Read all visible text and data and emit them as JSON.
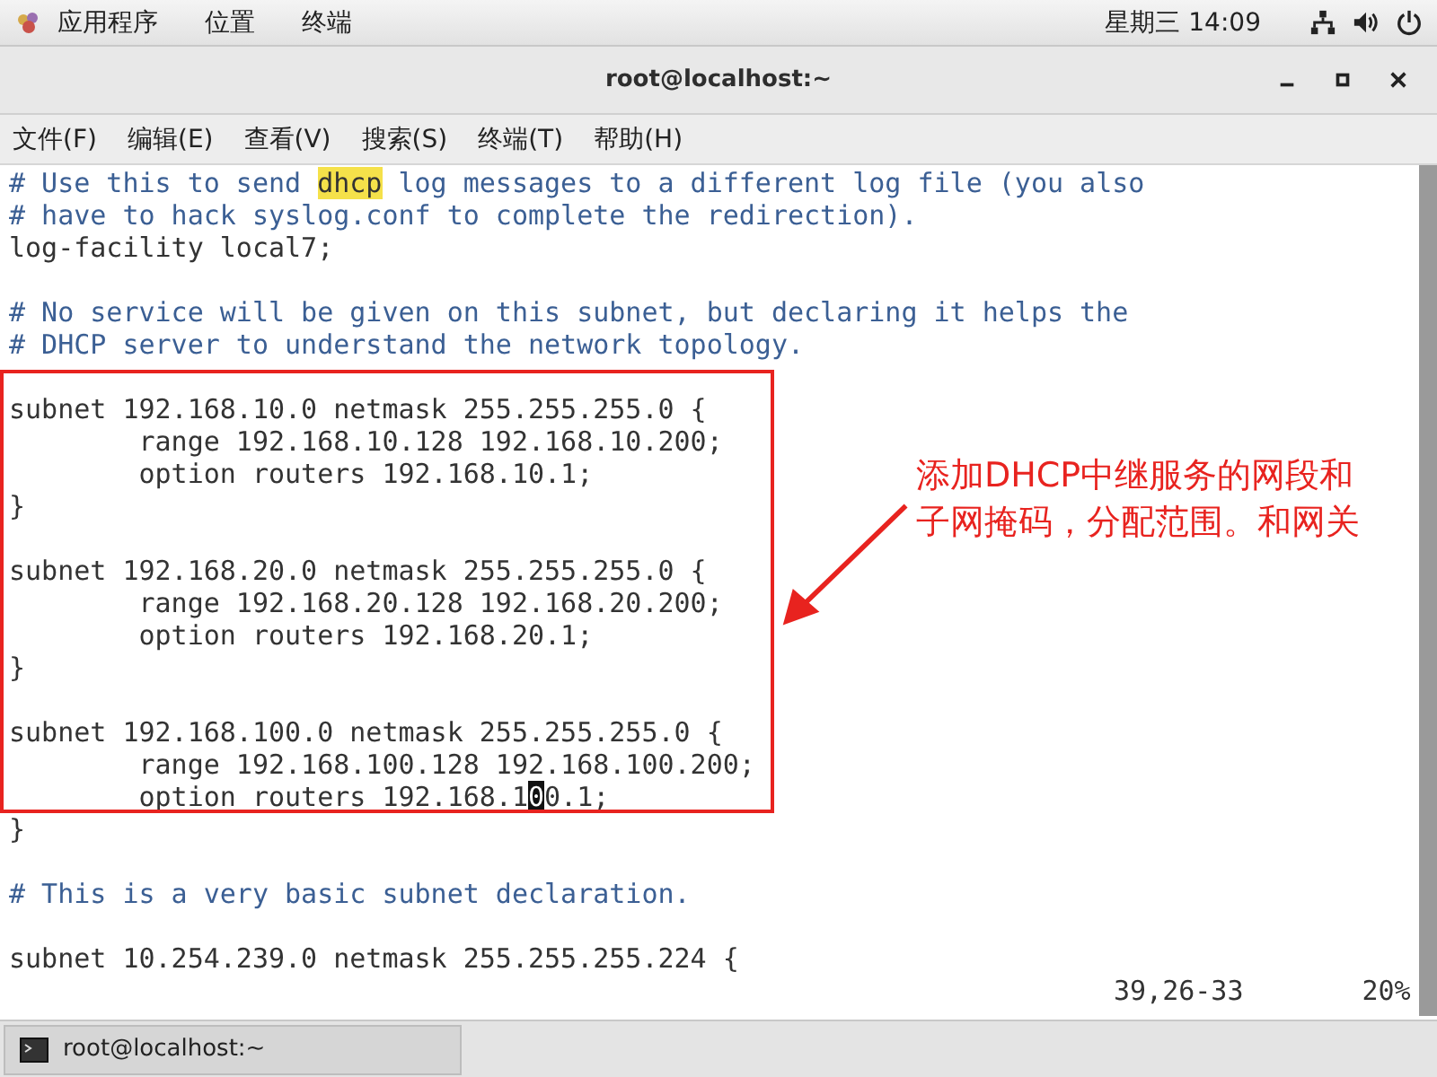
{
  "top_bar": {
    "menus": [
      "应用程序",
      "位置",
      "终端"
    ],
    "clock": "星期三 14:09"
  },
  "window": {
    "title": "root@localhost:~"
  },
  "menu_bar": [
    "文件(F)",
    "编辑(E)",
    "查看(V)",
    "搜索(S)",
    "终端(T)",
    "帮助(H)"
  ],
  "terminal": {
    "lines": [
      {
        "kind": "comment",
        "segments": [
          {
            "kind": "plain",
            "text": "# Use this to send "
          },
          {
            "kind": "match",
            "text": "dhcp"
          },
          {
            "kind": "plain",
            "text": " log messages to a different log file (you also"
          }
        ]
      },
      {
        "kind": "comment",
        "segments": [
          {
            "kind": "plain",
            "text": "# have to hack syslog.conf to complete the redirection)."
          }
        ]
      },
      {
        "kind": "code",
        "segments": [
          {
            "kind": "plain",
            "text": "log-facility local7;"
          }
        ]
      },
      {
        "kind": "blank"
      },
      {
        "kind": "comment",
        "segments": [
          {
            "kind": "plain",
            "text": "# No service will be given on this subnet, but declaring it helps the"
          }
        ]
      },
      {
        "kind": "comment",
        "segments": [
          {
            "kind": "plain",
            "text": "# DHCP server to understand the network topology."
          }
        ]
      },
      {
        "kind": "blank"
      },
      {
        "kind": "code",
        "segments": [
          {
            "kind": "plain",
            "text": "subnet 192.168.10.0 netmask 255.255.255.0 {"
          }
        ]
      },
      {
        "kind": "code",
        "segments": [
          {
            "kind": "plain",
            "text": "        range 192.168.10.128 192.168.10.200;"
          }
        ]
      },
      {
        "kind": "code",
        "segments": [
          {
            "kind": "plain",
            "text": "        option routers 192.168.10.1;"
          }
        ]
      },
      {
        "kind": "code",
        "segments": [
          {
            "kind": "plain",
            "text": "}"
          }
        ]
      },
      {
        "kind": "blank"
      },
      {
        "kind": "code",
        "segments": [
          {
            "kind": "plain",
            "text": "subnet 192.168.20.0 netmask 255.255.255.0 {"
          }
        ]
      },
      {
        "kind": "code",
        "segments": [
          {
            "kind": "plain",
            "text": "        range 192.168.20.128 192.168.20.200;"
          }
        ]
      },
      {
        "kind": "code",
        "segments": [
          {
            "kind": "plain",
            "text": "        option routers 192.168.20.1;"
          }
        ]
      },
      {
        "kind": "code",
        "segments": [
          {
            "kind": "plain",
            "text": "}"
          }
        ]
      },
      {
        "kind": "blank"
      },
      {
        "kind": "code",
        "segments": [
          {
            "kind": "plain",
            "text": "subnet 192.168.100.0 netmask 255.255.255.0 {"
          }
        ]
      },
      {
        "kind": "code",
        "segments": [
          {
            "kind": "plain",
            "text": "        range 192.168.100.128 192.168.100.200;"
          }
        ]
      },
      {
        "kind": "code",
        "segments": [
          {
            "kind": "plain",
            "text": "        option routers 192.168.1"
          },
          {
            "kind": "cursor",
            "text": "0"
          },
          {
            "kind": "plain",
            "text": "0.1;"
          }
        ]
      },
      {
        "kind": "code",
        "segments": [
          {
            "kind": "plain",
            "text": "}"
          }
        ]
      },
      {
        "kind": "blank"
      },
      {
        "kind": "comment",
        "segments": [
          {
            "kind": "plain",
            "text": "# This is a very basic subnet declaration."
          }
        ]
      },
      {
        "kind": "blank"
      },
      {
        "kind": "code",
        "segments": [
          {
            "kind": "plain",
            "text": "subnet 10.254.239.0 netmask 255.255.255.224 {"
          }
        ]
      }
    ],
    "status": {
      "position": "39,26-33",
      "percent": "20%"
    }
  },
  "annotation": {
    "text": "添加DHCP中继服务的网段和子网掩码，分配范围。和网关"
  },
  "taskbar": {
    "items": [
      {
        "label": "root@localhost:~",
        "selected": true
      }
    ]
  }
}
